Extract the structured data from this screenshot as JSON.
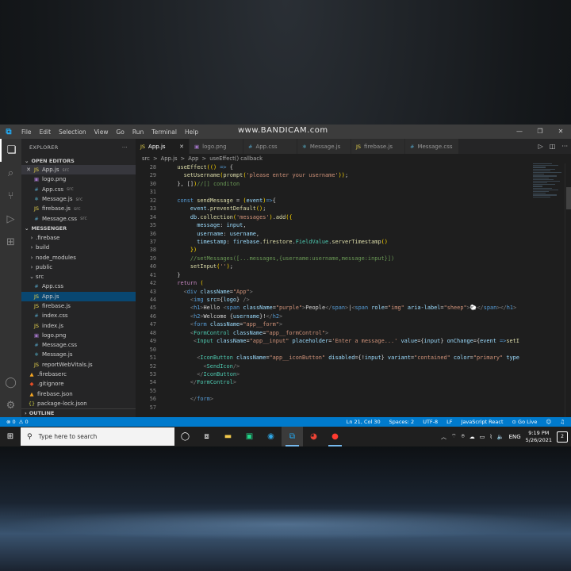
{
  "titlebar": {
    "menu": [
      "File",
      "Edit",
      "Selection",
      "View",
      "Go",
      "Run",
      "Terminal",
      "Help"
    ],
    "watermark": "www.BANDICAM.com"
  },
  "sidebar": {
    "title": "EXPLORER",
    "open_editors_label": "OPEN EDITORS",
    "open_editors": [
      {
        "name": "App.js",
        "sub": "src",
        "icon": "js",
        "close": "✕"
      },
      {
        "name": "logo.png",
        "sub": "",
        "icon": "img",
        "close": ""
      },
      {
        "name": "App.css",
        "sub": "src",
        "icon": "css",
        "close": ""
      },
      {
        "name": "Message.js",
        "sub": "src",
        "icon": "react",
        "close": ""
      },
      {
        "name": "firebase.js",
        "sub": "src",
        "icon": "js",
        "close": ""
      },
      {
        "name": "Message.css",
        "sub": "src",
        "icon": "css",
        "close": ""
      }
    ],
    "project_label": "MESSENGER",
    "tree": [
      {
        "name": ".firebase",
        "type": "folder"
      },
      {
        "name": "build",
        "type": "folder"
      },
      {
        "name": "node_modules",
        "type": "folder"
      },
      {
        "name": "public",
        "type": "folder"
      },
      {
        "name": "src",
        "type": "folder-open"
      },
      {
        "name": "App.css",
        "type": "css"
      },
      {
        "name": "App.js",
        "type": "js"
      },
      {
        "name": "firebase.js",
        "type": "js"
      },
      {
        "name": "index.css",
        "type": "css"
      },
      {
        "name": "index.js",
        "type": "js"
      },
      {
        "name": "logo.png",
        "type": "img"
      },
      {
        "name": "Message.css",
        "type": "css"
      },
      {
        "name": "Message.js",
        "type": "react"
      },
      {
        "name": "reportWebVitals.js",
        "type": "js"
      },
      {
        "name": ".firebaserc",
        "type": "fire"
      },
      {
        "name": ".gitignore",
        "type": "git"
      },
      {
        "name": "firebase.json",
        "type": "fire"
      },
      {
        "name": "package-lock.json",
        "type": "json"
      }
    ],
    "outline_label": "OUTLINE"
  },
  "tabs": [
    {
      "name": "App.js",
      "icon": "js"
    },
    {
      "name": "logo.png",
      "icon": "img"
    },
    {
      "name": "App.css",
      "icon": "css"
    },
    {
      "name": "Message.js",
      "icon": "react"
    },
    {
      "name": "firebase.js",
      "icon": "js"
    },
    {
      "name": "Message.css",
      "icon": "css"
    }
  ],
  "breadcrumb": [
    "src",
    ">",
    "App.js",
    ">",
    "App",
    ">",
    "useEffect() callback"
  ],
  "code_lines": [
    {
      "n": "28",
      "t": [
        [
          "",
          "  "
        ],
        [
          "fn",
          "useEffect"
        ],
        [
          "brk",
          "("
        ],
        [
          "brk",
          "()"
        ],
        [
          "kw",
          " =>"
        ],
        [
          "txt-w",
          " {"
        ]
      ]
    },
    {
      "n": "29",
      "t": [
        [
          "",
          "    "
        ],
        [
          "fn",
          "setUsername"
        ],
        [
          "brk",
          "("
        ],
        [
          "fn",
          "prompt"
        ],
        [
          "brk",
          "("
        ],
        [
          "str",
          "'please enter your username'"
        ],
        [
          "brk",
          "))"
        ],
        [
          "txt-w",
          ";"
        ]
      ]
    },
    {
      "n": "30",
      "t": [
        [
          "",
          "  "
        ],
        [
          "txt-w",
          "}, []"
        ],
        [
          "brk",
          ")"
        ],
        [
          "cmt",
          "//[] conditon"
        ]
      ]
    },
    {
      "n": "31",
      "t": [
        [
          "",
          ""
        ]
      ]
    },
    {
      "n": "32",
      "t": [
        [
          "",
          "  "
        ],
        [
          "kw",
          "const "
        ],
        [
          "fn",
          "sendMessage"
        ],
        [
          "txt-w",
          " = "
        ],
        [
          "brk",
          "("
        ],
        [
          "var",
          "event"
        ],
        [
          "brk",
          ")"
        ],
        [
          "kw",
          "=>"
        ],
        [
          "txt-w",
          "{"
        ]
      ]
    },
    {
      "n": "33",
      "t": [
        [
          "",
          "      "
        ],
        [
          "var",
          "event"
        ],
        [
          "txt-w",
          "."
        ],
        [
          "fn",
          "preventDefault"
        ],
        [
          "brk",
          "()"
        ],
        [
          "txt-w",
          ";"
        ]
      ]
    },
    {
      "n": "34",
      "t": [
        [
          "",
          "      "
        ],
        [
          "var",
          "db"
        ],
        [
          "txt-w",
          "."
        ],
        [
          "fn",
          "collection"
        ],
        [
          "brk",
          "("
        ],
        [
          "str",
          "'messages'"
        ],
        [
          "brk",
          ")"
        ],
        [
          "txt-w",
          "."
        ],
        [
          "fn",
          "add"
        ],
        [
          "brk",
          "({"
        ]
      ]
    },
    {
      "n": "35",
      "t": [
        [
          "",
          "        "
        ],
        [
          "var",
          "message"
        ],
        [
          "txt-w",
          ": "
        ],
        [
          "var",
          "input"
        ],
        [
          "txt-w",
          ","
        ]
      ]
    },
    {
      "n": "36",
      "t": [
        [
          "",
          "        "
        ],
        [
          "var",
          "username"
        ],
        [
          "txt-w",
          ": "
        ],
        [
          "var",
          "username"
        ],
        [
          "txt-w",
          ","
        ]
      ]
    },
    {
      "n": "37",
      "t": [
        [
          "",
          "        "
        ],
        [
          "var",
          "timestamp"
        ],
        [
          "txt-w",
          ": "
        ],
        [
          "var",
          "firebase"
        ],
        [
          "txt-w",
          "."
        ],
        [
          "fn",
          "firestore"
        ],
        [
          "txt-w",
          "."
        ],
        [
          "comp",
          "FieldValue"
        ],
        [
          "txt-w",
          "."
        ],
        [
          "fn",
          "serverTimestamp"
        ],
        [
          "brk",
          "()"
        ]
      ]
    },
    {
      "n": "38",
      "t": [
        [
          "",
          "      "
        ],
        [
          "brk",
          "})"
        ]
      ]
    },
    {
      "n": "39",
      "t": [
        [
          "",
          "      "
        ],
        [
          "cmt",
          "//setMessages([...messages,{username:username,message:input}])"
        ]
      ]
    },
    {
      "n": "40",
      "t": [
        [
          "",
          "      "
        ],
        [
          "fn",
          "setInput"
        ],
        [
          "brk",
          "("
        ],
        [
          "str",
          "''"
        ],
        [
          "brk",
          ")"
        ],
        [
          "txt-w",
          ";"
        ]
      ]
    },
    {
      "n": "41",
      "t": [
        [
          "",
          "  "
        ],
        [
          "txt-w",
          "}"
        ]
      ]
    },
    {
      "n": "42",
      "t": [
        [
          "",
          "  "
        ],
        [
          "ctl",
          "return "
        ],
        [
          "brk",
          "("
        ]
      ]
    },
    {
      "n": "43",
      "t": [
        [
          "",
          "    "
        ],
        [
          "pun",
          "<"
        ],
        [
          "tag",
          "div "
        ],
        [
          "attr",
          "className"
        ],
        [
          "txt-w",
          "="
        ],
        [
          "str",
          "\"App\""
        ],
        [
          "pun",
          ">"
        ]
      ]
    },
    {
      "n": "44",
      "t": [
        [
          "",
          "      "
        ],
        [
          "pun",
          "<"
        ],
        [
          "tag",
          "img "
        ],
        [
          "attr",
          "src"
        ],
        [
          "txt-w",
          "={"
        ],
        [
          "var",
          "logo"
        ],
        [
          "txt-w",
          "} "
        ],
        [
          "pun",
          "/>"
        ]
      ]
    },
    {
      "n": "45",
      "t": [
        [
          "",
          "      "
        ],
        [
          "pun",
          "<"
        ],
        [
          "tag",
          "h1"
        ],
        [
          "pun",
          ">"
        ],
        [
          "txt-w",
          "Hello "
        ],
        [
          "pun",
          "<"
        ],
        [
          "tag",
          "span "
        ],
        [
          "attr",
          "className"
        ],
        [
          "txt-w",
          "="
        ],
        [
          "str",
          "\"purple\""
        ],
        [
          "pun",
          ">"
        ],
        [
          "txt-w",
          "People"
        ],
        [
          "pun",
          "</"
        ],
        [
          "tag",
          "span"
        ],
        [
          "pun",
          ">"
        ],
        [
          "txt-w",
          "|"
        ],
        [
          "pun",
          "<"
        ],
        [
          "tag",
          "span "
        ],
        [
          "attr",
          "role"
        ],
        [
          "txt-w",
          "="
        ],
        [
          "str",
          "\"img\" "
        ],
        [
          "attr",
          "aria-label"
        ],
        [
          "txt-w",
          "="
        ],
        [
          "str",
          "\"sheep\""
        ],
        [
          "pun",
          ">"
        ],
        [
          "txt-w",
          "🐑"
        ],
        [
          "pun",
          "</"
        ],
        [
          "tag",
          "span"
        ],
        [
          "pun",
          ">"
        ],
        [
          "pun",
          "</"
        ],
        [
          "tag",
          "h1"
        ],
        [
          "pun",
          ">"
        ]
      ]
    },
    {
      "n": "46",
      "t": [
        [
          "",
          "      "
        ],
        [
          "pun",
          "<"
        ],
        [
          "tag",
          "h2"
        ],
        [
          "pun",
          ">"
        ],
        [
          "txt-w",
          "Welcome {"
        ],
        [
          "var",
          "username"
        ],
        [
          "txt-w",
          "}!"
        ],
        [
          "pun",
          "</"
        ],
        [
          "tag",
          "h2"
        ],
        [
          "pun",
          ">"
        ]
      ]
    },
    {
      "n": "47",
      "t": [
        [
          "",
          "      "
        ],
        [
          "pun",
          "<"
        ],
        [
          "tag",
          "form "
        ],
        [
          "attr",
          "className"
        ],
        [
          "txt-w",
          "="
        ],
        [
          "str",
          "\"app__form\""
        ],
        [
          "pun",
          ">"
        ]
      ]
    },
    {
      "n": "48",
      "t": [
        [
          "",
          "      "
        ],
        [
          "pun",
          "<"
        ],
        [
          "comp",
          "FormControl "
        ],
        [
          "attr",
          "className"
        ],
        [
          "txt-w",
          "="
        ],
        [
          "str",
          "\"app__formControl\""
        ],
        [
          "pun",
          ">"
        ]
      ]
    },
    {
      "n": "49",
      "t": [
        [
          "",
          "       "
        ],
        [
          "pun",
          "<"
        ],
        [
          "comp",
          "Input "
        ],
        [
          "attr",
          "className"
        ],
        [
          "txt-w",
          "="
        ],
        [
          "str",
          "\"app__input\" "
        ],
        [
          "attr",
          "placeholder"
        ],
        [
          "txt-w",
          "="
        ],
        [
          "str",
          "'Enter a message...' "
        ],
        [
          "attr",
          "value"
        ],
        [
          "txt-w",
          "={"
        ],
        [
          "var",
          "input"
        ],
        [
          "txt-w",
          "} "
        ],
        [
          "attr",
          "onChange"
        ],
        [
          "txt-w",
          "={"
        ],
        [
          "var",
          "event"
        ],
        [
          "kw",
          " =>"
        ],
        [
          "fn",
          "setI"
        ]
      ]
    },
    {
      "n": "50",
      "t": [
        [
          "",
          ""
        ]
      ]
    },
    {
      "n": "51",
      "t": [
        [
          "",
          "        "
        ],
        [
          "pun",
          "<"
        ],
        [
          "comp",
          "IconButton "
        ],
        [
          "attr",
          "className"
        ],
        [
          "txt-w",
          "="
        ],
        [
          "str",
          "\"app__iconButton\" "
        ],
        [
          "attr",
          "disabled"
        ],
        [
          "txt-w",
          "={"
        ],
        [
          "txt-w",
          "!"
        ],
        [
          "var",
          "input"
        ],
        [
          "txt-w",
          "} "
        ],
        [
          "attr",
          "variant"
        ],
        [
          "txt-w",
          "="
        ],
        [
          "str",
          "\"contained\" "
        ],
        [
          "attr",
          "color"
        ],
        [
          "txt-w",
          "="
        ],
        [
          "str",
          "\"primary\" "
        ],
        [
          "attr",
          "type"
        ]
      ]
    },
    {
      "n": "52",
      "t": [
        [
          "",
          "          "
        ],
        [
          "pun",
          "<"
        ],
        [
          "comp",
          "SendIcon"
        ],
        [
          "pun",
          "/>"
        ]
      ]
    },
    {
      "n": "53",
      "t": [
        [
          "",
          "        "
        ],
        [
          "pun",
          "</"
        ],
        [
          "comp",
          "IconButton"
        ],
        [
          "pun",
          ">"
        ]
      ]
    },
    {
      "n": "54",
      "t": [
        [
          "",
          "      "
        ],
        [
          "pun",
          "</"
        ],
        [
          "comp",
          "FormControl"
        ],
        [
          "pun",
          ">"
        ]
      ]
    },
    {
      "n": "55",
      "t": [
        [
          "",
          ""
        ]
      ]
    },
    {
      "n": "56",
      "t": [
        [
          "",
          "      "
        ],
        [
          "pun",
          "</"
        ],
        [
          "tag",
          "form"
        ],
        [
          "pun",
          ">"
        ]
      ]
    },
    {
      "n": "57",
      "t": [
        [
          "",
          ""
        ]
      ]
    }
  ],
  "statusbar": {
    "errors": "⊗ 0",
    "warnings": "⚠ 0",
    "position": "Ln 21, Col 30",
    "spaces": "Spaces: 2",
    "encoding": "UTF-8",
    "eol": "LF",
    "language": "JavaScript React",
    "golive": "⊙ Go Live"
  },
  "taskbar": {
    "search_placeholder": "Type here to search",
    "lang": "ENG",
    "time": "9:19 PM",
    "date": "5/26/2021",
    "notifications": "2"
  }
}
